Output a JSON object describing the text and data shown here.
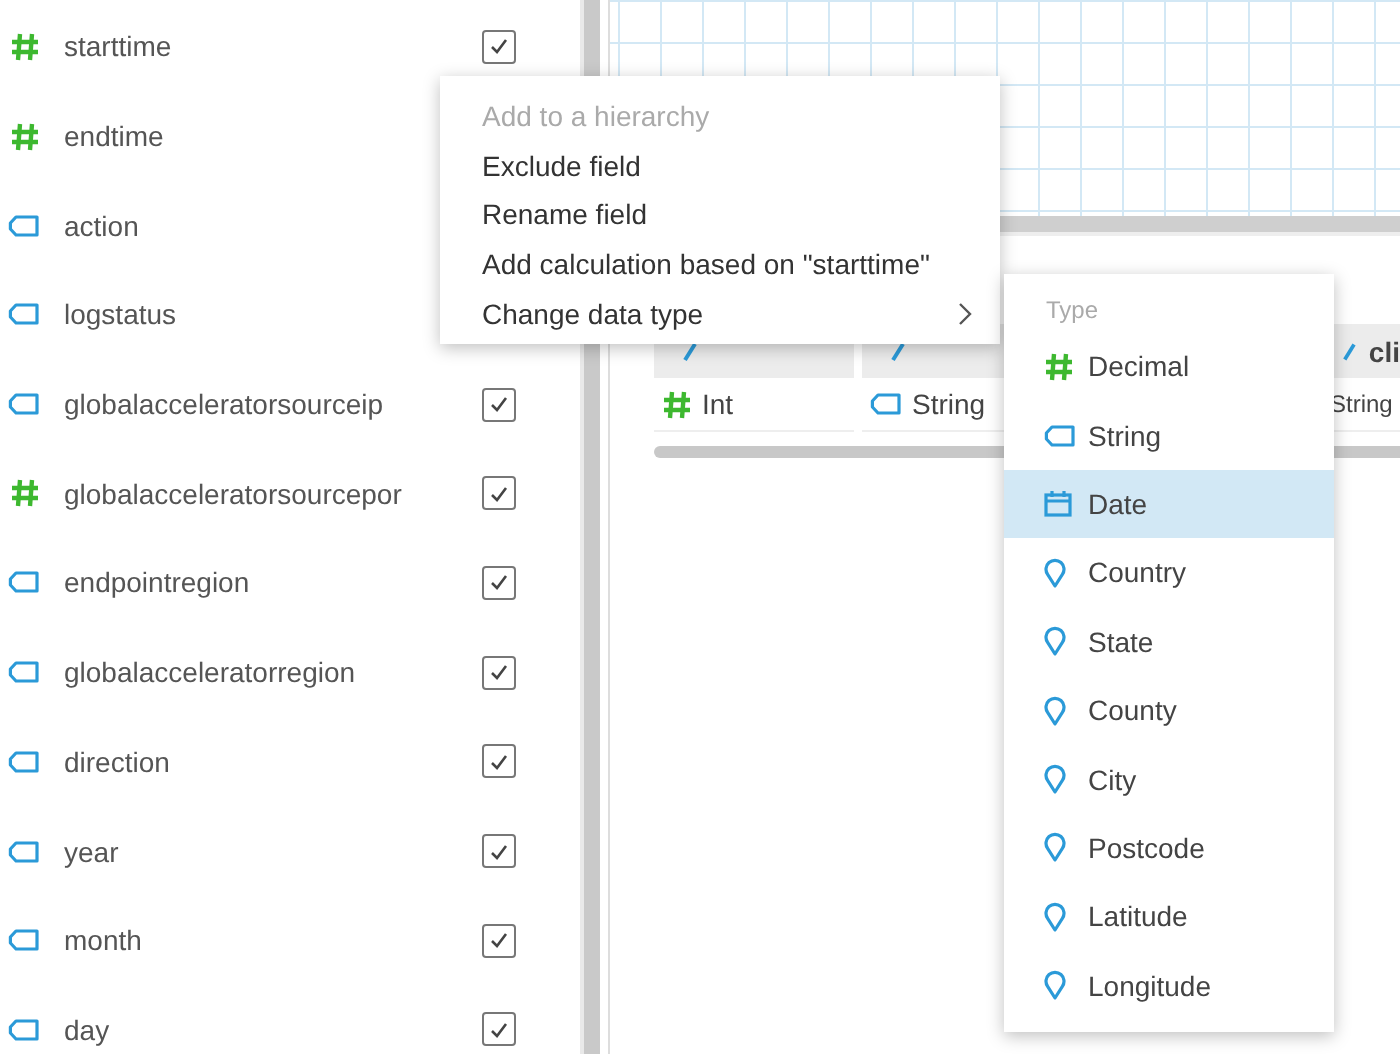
{
  "fields": [
    {
      "name": "starttime",
      "kind": "number",
      "checked": true
    },
    {
      "name": "endtime",
      "kind": "number"
    },
    {
      "name": "action",
      "kind": "string"
    },
    {
      "name": "logstatus",
      "kind": "string"
    },
    {
      "name": "globalacceleratorsourceip",
      "kind": "string",
      "checked": true
    },
    {
      "name": "globalacceleratorsourcepor",
      "kind": "number",
      "checked": true
    },
    {
      "name": "endpointregion",
      "kind": "string",
      "checked": true
    },
    {
      "name": "globalacceleratorregion",
      "kind": "string",
      "checked": true
    },
    {
      "name": "direction",
      "kind": "string",
      "checked": true
    },
    {
      "name": "year",
      "kind": "string",
      "checked": true
    },
    {
      "name": "month",
      "kind": "string",
      "checked": true
    },
    {
      "name": "day",
      "kind": "string",
      "checked": true
    }
  ],
  "preview": {
    "columns": [
      {},
      {},
      {
        "header": "cli"
      }
    ],
    "types": [
      {
        "label": "Int",
        "kind": "number"
      },
      {
        "label": "String",
        "kind": "string"
      },
      {
        "label": "String",
        "kind": "none"
      }
    ]
  },
  "context_menu": [
    {
      "label": "Add to a hierarchy",
      "disabled": true,
      "submenu": false
    },
    {
      "label": "Exclude field",
      "disabled": false,
      "submenu": false
    },
    {
      "label": "Rename field",
      "disabled": false,
      "submenu": false
    },
    {
      "label": "Add calculation based on \"starttime\"",
      "disabled": false,
      "submenu": false
    },
    {
      "label": "Change data type",
      "disabled": false,
      "submenu": true
    }
  ],
  "type_menu": {
    "heading": "Type",
    "items": [
      {
        "label": "Decimal",
        "kind": "number",
        "selected": false
      },
      {
        "label": "String",
        "kind": "string",
        "selected": false
      },
      {
        "label": "Date",
        "kind": "date",
        "selected": true
      },
      {
        "label": "Country",
        "kind": "geo",
        "selected": false
      },
      {
        "label": "State",
        "kind": "geo",
        "selected": false
      },
      {
        "label": "County",
        "kind": "geo",
        "selected": false
      },
      {
        "label": "City",
        "kind": "geo",
        "selected": false
      },
      {
        "label": "Postcode",
        "kind": "geo",
        "selected": false
      },
      {
        "label": "Latitude",
        "kind": "geo",
        "selected": false
      },
      {
        "label": "Longitude",
        "kind": "geo",
        "selected": false
      }
    ]
  }
}
